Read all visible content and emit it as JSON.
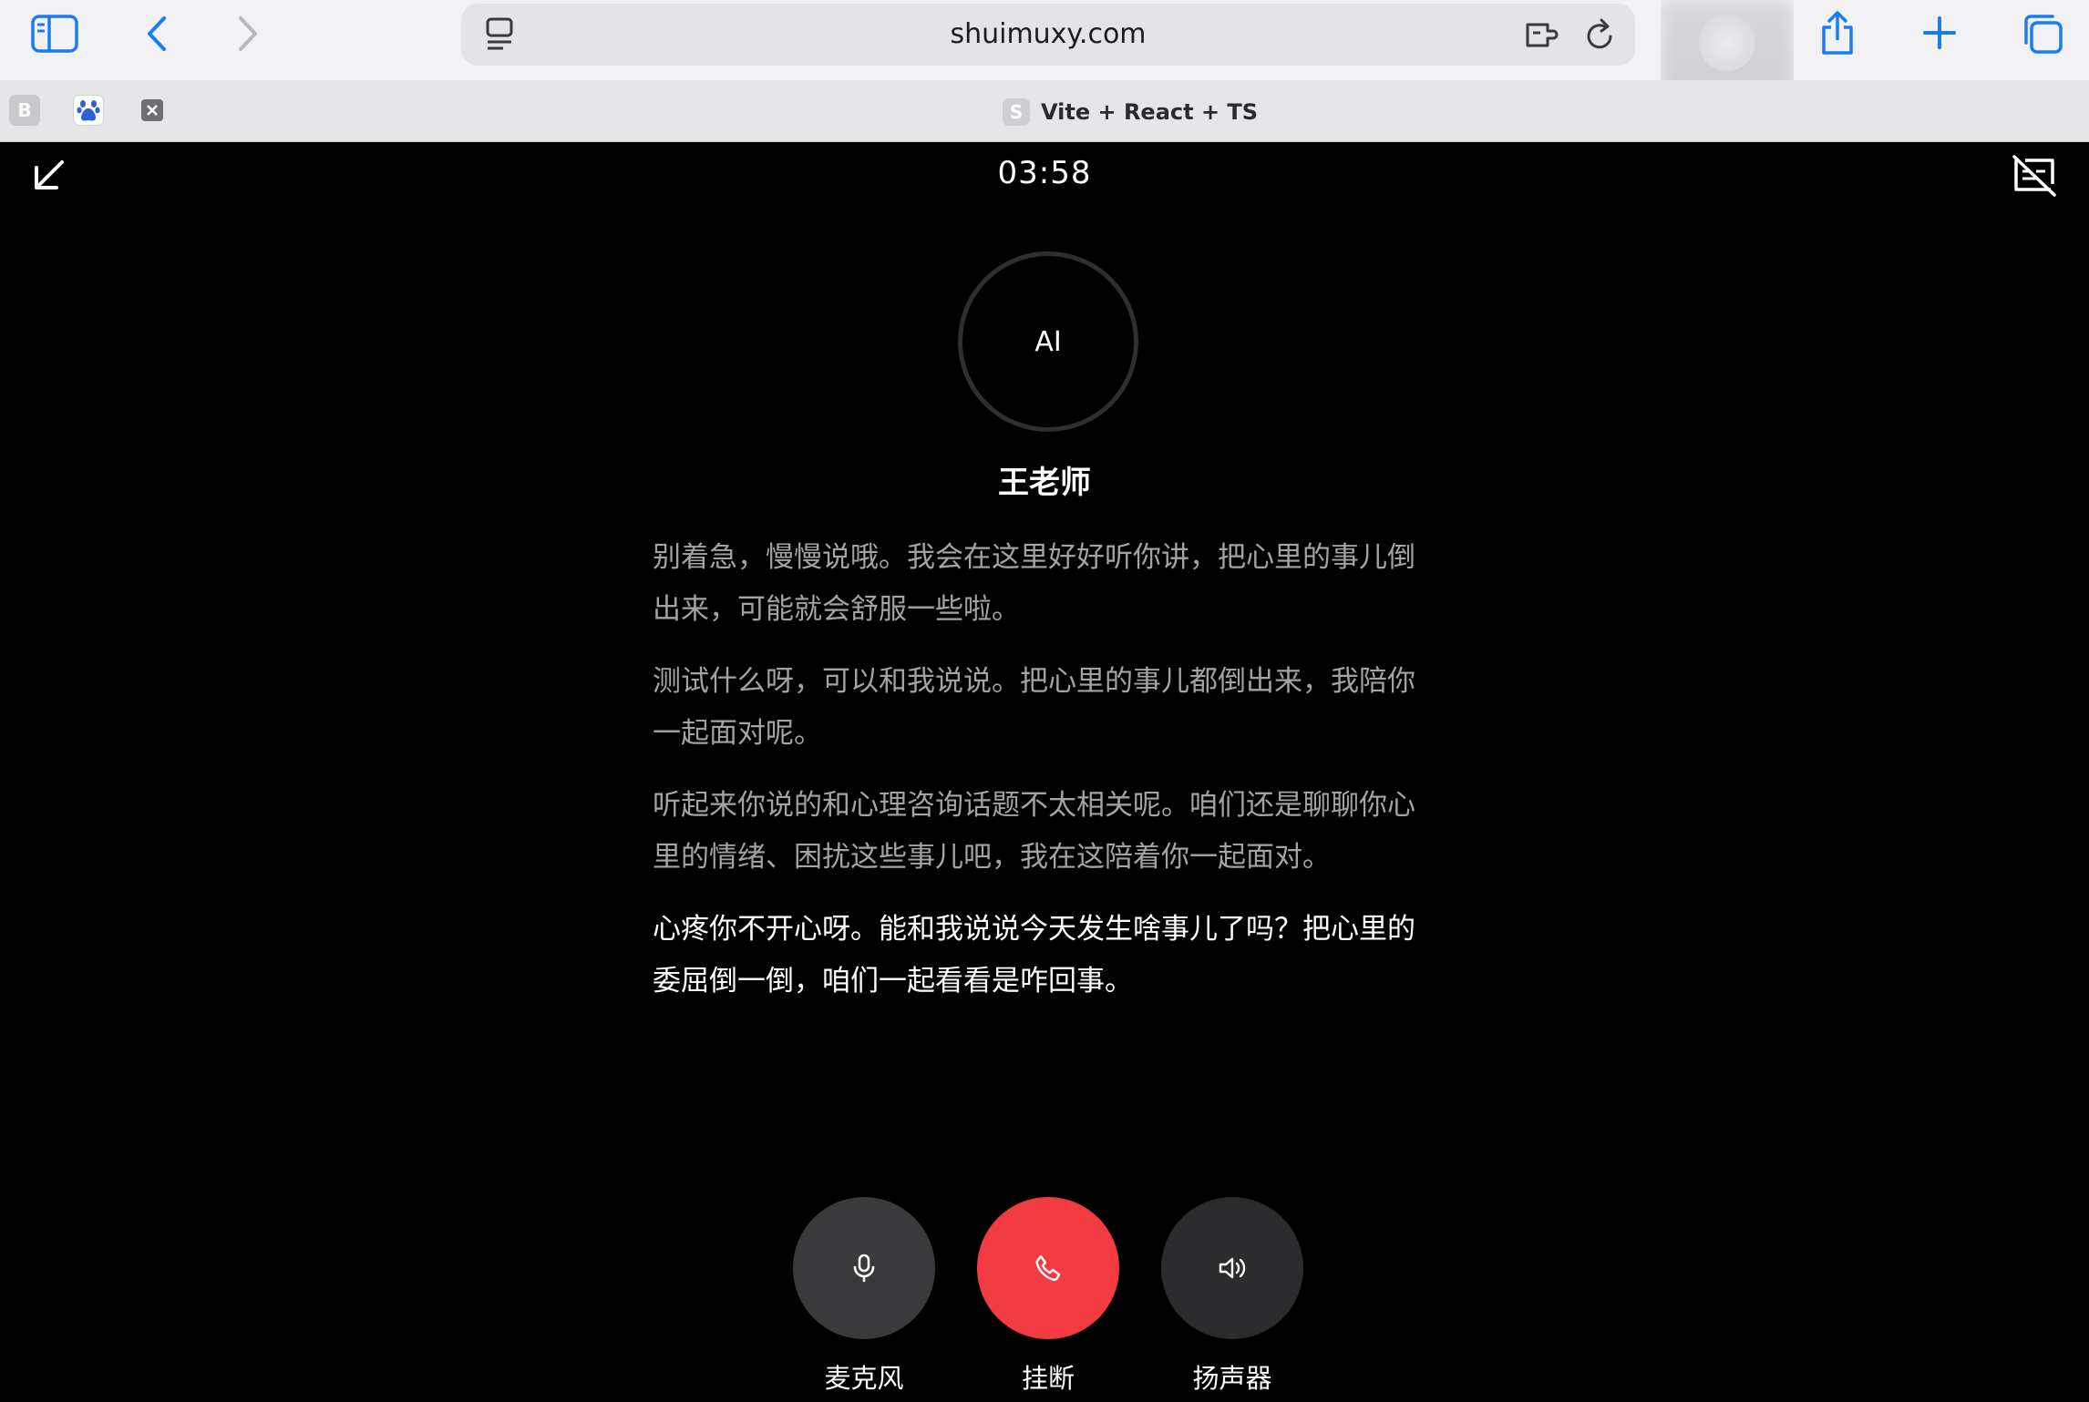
{
  "browser": {
    "url": "shuimuxy.com",
    "tabs": [
      {
        "favicon_letter": "B"
      },
      {
        "favicon_icon": "paw-icon"
      },
      {
        "favicon_icon": "close-tab-icon"
      }
    ],
    "active_tab_title": "Vite + React + TS",
    "active_tab_favicon_letter": "S",
    "accent_color": "#1a7cf5"
  },
  "call": {
    "timer": "03:58",
    "avatar_label": "AI",
    "agent_name": "王老师",
    "messages": [
      "别着急，慢慢说哦。我会在这里好好听你讲，把心里的事儿倒出来，可能就会舒服一些啦。",
      "测试什么呀，可以和我说说。把心里的事儿都倒出来，我陪你一起面对呢。",
      "听起来你说的和心理咨询话题不太相关呢。咱们还是聊聊你心里的情绪、困扰这些事儿吧，我在这陪着你一起面对。",
      "心疼你不开心呀。能和我说说今天发生啥事儿了吗？把心里的委屈倒一倒，咱们一起看看是咋回事。"
    ],
    "controls": {
      "mic_label": "麦克风",
      "hangup_label": "挂断",
      "speaker_label": "扬声器"
    },
    "colors": {
      "hangup": "#f23c41",
      "control_gray": "#3a3a3c",
      "speaker_gray": "#2c2c2e"
    }
  }
}
